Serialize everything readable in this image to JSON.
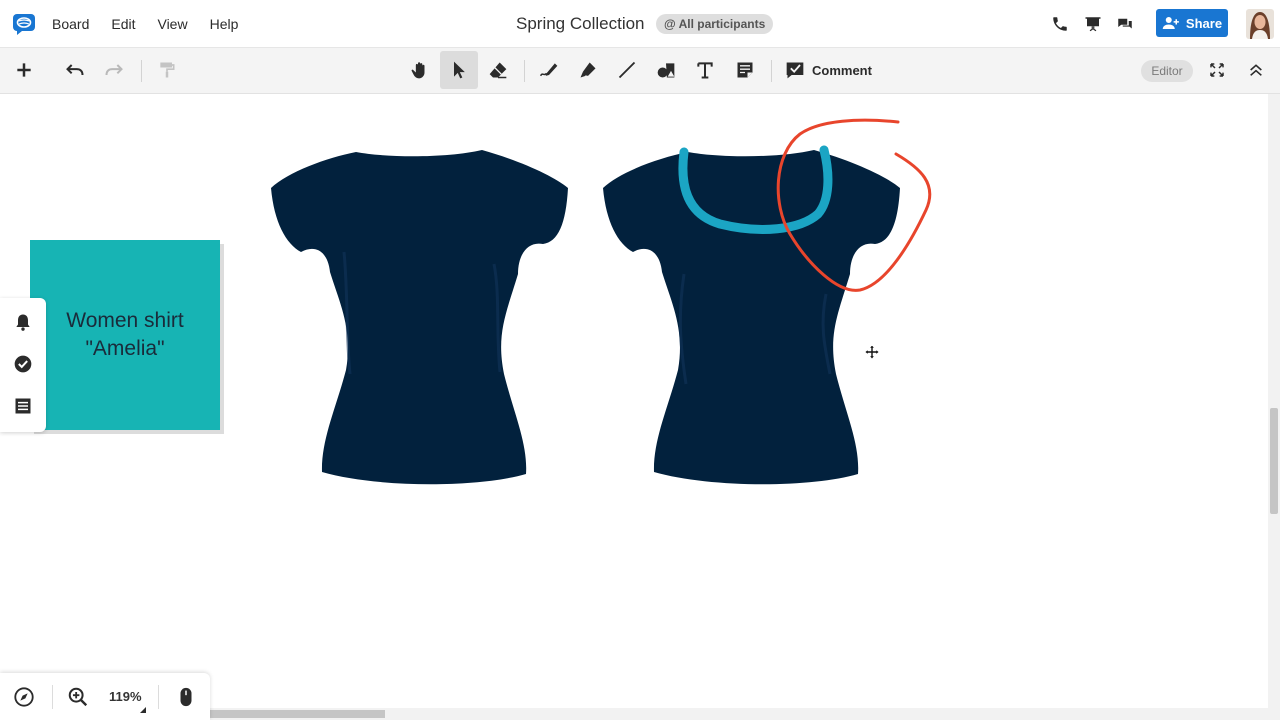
{
  "app": {
    "board_title": "Spring Collection",
    "participants_badge": "@ All participants"
  },
  "menu": {
    "items": [
      "Board",
      "Edit",
      "View",
      "Help"
    ]
  },
  "header": {
    "share_label": "Share",
    "icons": [
      "phone-icon",
      "presentation-icon",
      "chat-icon"
    ]
  },
  "toolbar": {
    "comment_label": "Comment",
    "editor_label": "Editor",
    "tools": [
      "add-icon",
      "undo-icon",
      "redo-icon",
      "format-painter-icon",
      "hand-icon",
      "select-arrow-icon",
      "eraser-icon",
      "pen-icon",
      "highlighter-icon",
      "line-icon",
      "shapes-icon",
      "text-icon",
      "sticky-note-icon",
      "comment-icon",
      "fullscreen-icon",
      "collapse-icon"
    ],
    "active_tool": "select"
  },
  "canvas": {
    "sticky_note": {
      "text": "Women shirt\n\"Amelia\"",
      "color": "#17b4b4"
    },
    "shirt_color": "#02213d",
    "neckline_color": "#1ba5c4",
    "annotation_color": "#e8452c"
  },
  "side_panel": {
    "icons": [
      "bell-icon",
      "checkmark-icon",
      "list-icon"
    ]
  },
  "bottom_panel": {
    "zoom_level": "119%",
    "icons": [
      "compass-icon",
      "zoom-icon",
      "mouse-icon"
    ]
  }
}
